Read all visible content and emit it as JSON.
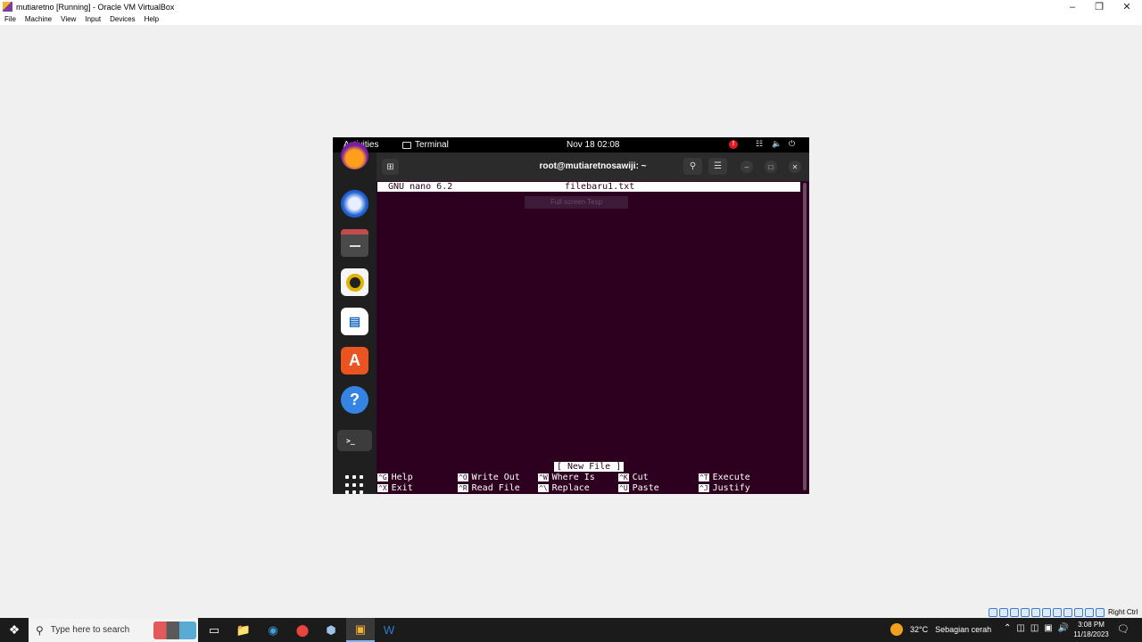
{
  "vbox": {
    "title": "mutiaretno [Running] - Oracle VM VirtualBox",
    "menu": [
      "File",
      "Machine",
      "View",
      "Input",
      "Devices",
      "Help"
    ],
    "host_key": "Right Ctrl"
  },
  "gnome": {
    "activities": "Activities",
    "app_name": "Terminal",
    "clock": "Nov 18  02:08",
    "alert": "!"
  },
  "terminal": {
    "title": "root@mutiaretnosawiji: ~"
  },
  "nano": {
    "version": "GNU nano 6.2",
    "filename": "filebaru1.txt",
    "hint": "Full screen Tesp",
    "status": "[ New File ]",
    "shortcuts": [
      {
        "key": "^G",
        "label": "Help"
      },
      {
        "key": "^O",
        "label": "Write Out"
      },
      {
        "key": "^W",
        "label": "Where Is"
      },
      {
        "key": "^K",
        "label": "Cut"
      },
      {
        "key": "^T",
        "label": "Execute"
      },
      {
        "key": "^X",
        "label": "Exit"
      },
      {
        "key": "^R",
        "label": "Read File"
      },
      {
        "key": "^\\",
        "label": "Replace"
      },
      {
        "key": "^U",
        "label": "Paste"
      },
      {
        "key": "^J",
        "label": "Justify"
      }
    ]
  },
  "taskbar": {
    "search_placeholder": "Type here to search",
    "weather_temp": "32°C",
    "weather_desc": "Sebagian cerah",
    "time": "3:08 PM",
    "date": "11/18/2023"
  }
}
